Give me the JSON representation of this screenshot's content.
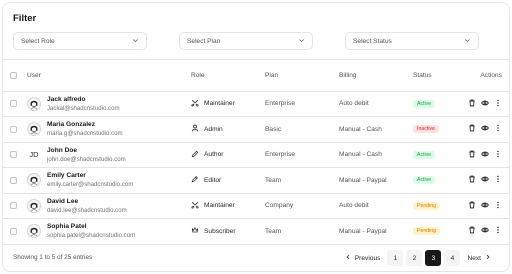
{
  "filter": {
    "title": "Filter",
    "role_placeholder": "Select Role",
    "plan_placeholder": "Select Plan",
    "status_placeholder": "Select Status"
  },
  "table": {
    "headers": {
      "user": "User",
      "role": "Role",
      "plan": "Plan",
      "billing": "Billing",
      "status": "Status",
      "actions": "Actions"
    },
    "rows": [
      {
        "name": "Jack alfredo",
        "email": "Jackal@shadcnstudio.com",
        "avatar": "avatar-illustration",
        "role": "Maintainer",
        "role_icon": "maintainer-icon",
        "plan": "Enterprise",
        "billing": "Auto debit",
        "status": "Active",
        "status_kind": "active"
      },
      {
        "name": "Maria Gonzalez",
        "email": "maria.g@shadcnstudio.com",
        "avatar": "avatar-illustration",
        "role": "Admin",
        "role_icon": "user-icon",
        "plan": "Basic",
        "billing": "Manual - Cash",
        "status": "Inactive",
        "status_kind": "inactive"
      },
      {
        "name": "John Doe",
        "email": "john.doe@shadcnstudio.com",
        "avatar_initials": "JD",
        "role": "Author",
        "role_icon": "pencil-icon",
        "plan": "Enterprise",
        "billing": "Manual - Cash",
        "status": "Active",
        "status_kind": "active"
      },
      {
        "name": "Emily Carter",
        "email": "emily.carter@shadcnstudio.com",
        "avatar": "avatar-illustration",
        "role": "Editor",
        "role_icon": "pen-icon",
        "plan": "Team",
        "billing": "Manual - Paypal",
        "status": "Active",
        "status_kind": "active"
      },
      {
        "name": "David Lee",
        "email": "david.lee@shadcnstudio.com",
        "avatar": "avatar-illustration",
        "role": "Maintainer",
        "role_icon": "maintainer-icon",
        "plan": "Company",
        "billing": "Auto debit",
        "status": "Pending",
        "status_kind": "pending"
      },
      {
        "name": "Sophia Patel",
        "email": "sophia.patel@shadcnstudio.com",
        "avatar": "avatar-illustration",
        "role": "Subscriber",
        "role_icon": "crown-icon",
        "plan": "Team",
        "billing": "Manual - Paypal",
        "status": "Pending",
        "status_kind": "pending"
      }
    ]
  },
  "footer": {
    "summary": "Showing 1 to 5 of 25 entries",
    "previous": "Previous",
    "next": "Next",
    "pages": [
      "1",
      "2",
      "3",
      "4"
    ],
    "current_page": "3"
  },
  "colors": {
    "active": "#16a34a",
    "inactive": "#dc2626",
    "pending": "#d97706",
    "primary": "#18181b"
  }
}
